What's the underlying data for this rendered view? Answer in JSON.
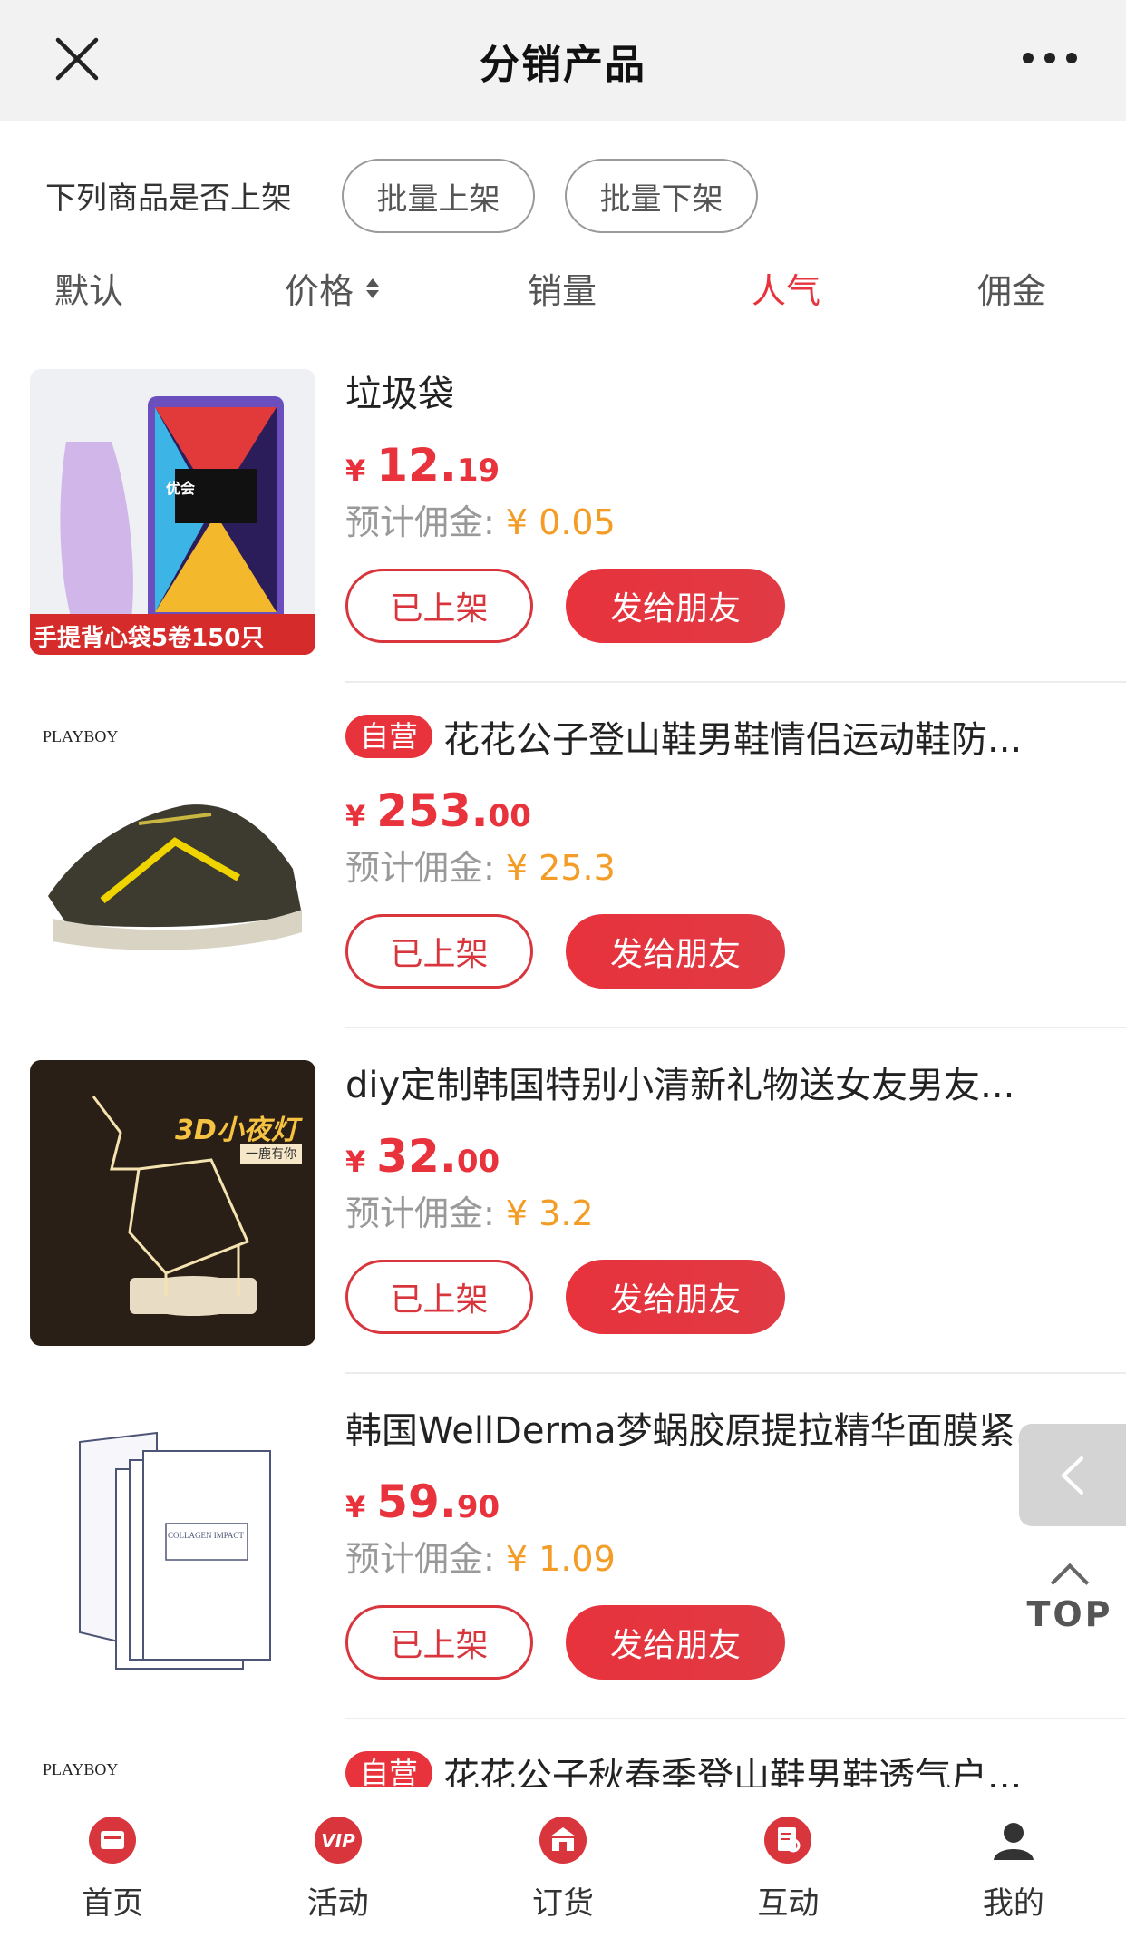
{
  "header": {
    "title": "分销产品"
  },
  "batch": {
    "question": "下列商品是否上架",
    "list_all": "批量上架",
    "delist_all": "批量下架"
  },
  "sort": {
    "default": "默认",
    "price": "价格",
    "sales": "销量",
    "popularity": "人气",
    "commission": "佣金",
    "active": "人气"
  },
  "products": [
    {
      "tag": "",
      "title": "垃圾袋",
      "currency": "¥",
      "price_int": "12.",
      "price_dec": "19",
      "commission_label": "预计佣金:",
      "commission_value": "¥ 0.05",
      "listed_label": "已上架",
      "send_label": "发给朋友",
      "thumb_text": "手提背心袋5卷150只",
      "brand_text": "优会"
    },
    {
      "tag": "自营",
      "title": "花花公子登山鞋男鞋情侣运动鞋防...",
      "currency": "¥",
      "price_int": "253.",
      "price_dec": "00",
      "commission_label": "预计佣金:",
      "commission_value": "¥ 25.3",
      "listed_label": "已上架",
      "send_label": "发给朋友",
      "brand_text": "PLAYBOY"
    },
    {
      "tag": "",
      "title": "diy定制韩国特别小清新礼物送女友男友...",
      "currency": "¥",
      "price_int": "32.",
      "price_dec": "00",
      "commission_label": "预计佣金:",
      "commission_value": "¥ 3.2",
      "listed_label": "已上架",
      "send_label": "发给朋友",
      "thumb_text": "3D小夜灯",
      "thumb_sub": "一鹿有你"
    },
    {
      "tag": "",
      "title": "韩国WellDerma梦蜗胶原提拉精华面膜紧...",
      "currency": "¥",
      "price_int": "59.",
      "price_dec": "90",
      "commission_label": "预计佣金:",
      "commission_value": "¥ 1.09",
      "listed_label": "已上架",
      "send_label": "发给朋友",
      "thumb_text": "COLLAGEN IMPACT"
    },
    {
      "tag": "自营",
      "title": "花花公子秋春季登山鞋男鞋透气户...",
      "brand_text": "PLAYBOY"
    }
  ],
  "floating": {
    "top_label": "TOP"
  },
  "tabbar": {
    "items": [
      "首页",
      "活动",
      "订货",
      "互动",
      "我的"
    ]
  },
  "colors": {
    "accent": "#e8323c",
    "commission": "#f39c26",
    "header_bg": "#f2f2f2"
  }
}
